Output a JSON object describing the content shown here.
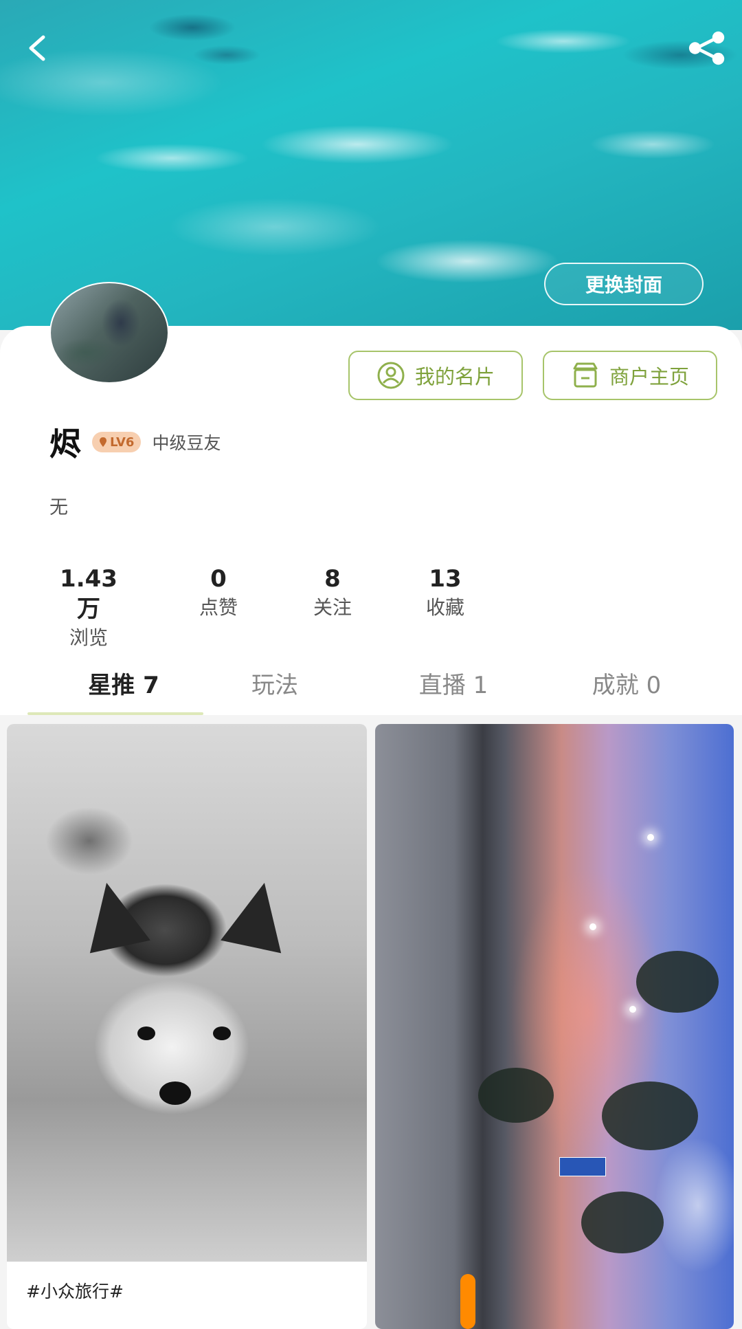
{
  "header": {
    "back_icon": "chevron-left-icon",
    "share_icon": "share-icon",
    "change_cover_label": "更换封面"
  },
  "profile": {
    "name": "烬",
    "level": "LV6",
    "rank_title": "中级豆友",
    "bio": "无",
    "buttons": {
      "my_card": "我的名片",
      "merchant_home": "商户主页"
    },
    "stats": [
      {
        "value": "1.43万",
        "label": "浏览"
      },
      {
        "value": "0",
        "label": "点赞"
      },
      {
        "value": "8",
        "label": "关注"
      },
      {
        "value": "13",
        "label": "收藏"
      }
    ]
  },
  "tabs": [
    {
      "label": "星推 7",
      "active": true
    },
    {
      "label": "玩法",
      "active": false
    },
    {
      "label": "直播 1",
      "active": false
    },
    {
      "label": "成就 0",
      "active": false
    }
  ],
  "feed": [
    {
      "hashtag": "#小众旅行#"
    }
  ],
  "colors": {
    "accent_green": "#7fa23c",
    "accent_border": "#a7c46a",
    "badge_bg": "#f7cfb0"
  }
}
